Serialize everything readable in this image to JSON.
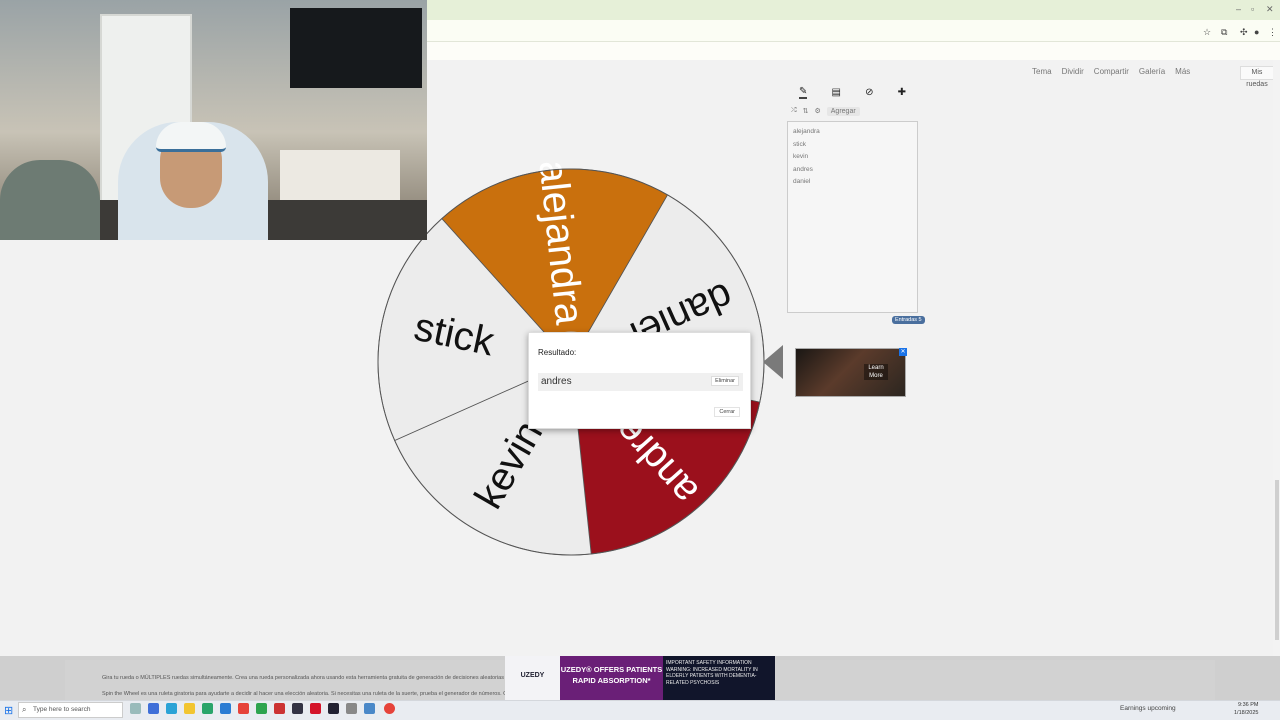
{
  "browser": {
    "window_controls": [
      "–",
      "▫",
      "✕"
    ]
  },
  "site_nav": {
    "items": [
      "Tema",
      "Dividir",
      "Compartir",
      "Galería",
      "Más"
    ],
    "language_button": "Mis ruedas"
  },
  "wheel": {
    "segments": [
      {
        "label": "daniel",
        "color": "#ececec"
      },
      {
        "label": "andres",
        "color": "#9b101c"
      },
      {
        "label": "kevin",
        "color": "#ececec"
      },
      {
        "label": "stick",
        "color": "#ececec"
      },
      {
        "label": "alejandra",
        "color": "#c9700d"
      }
    ]
  },
  "side_panel": {
    "tabs": [
      "pencil-icon",
      "clipboard-icon",
      "eye-off-icon",
      "add-image-icon"
    ],
    "toolbar": {
      "shuffle": "⤮",
      "sort": "⇅",
      "add_image_label": "Agregar"
    },
    "entries": [
      "alejandra",
      "stick",
      "kevin",
      "andres",
      "daniel"
    ],
    "entries_count": "Entradas 5"
  },
  "ad": {
    "learn_more": "Learn More"
  },
  "result_dialog": {
    "title": "Resultado:",
    "winner": "andres",
    "remove_label": "Eliminar",
    "close_label": "Cerrar"
  },
  "footer": {
    "line1": "Gira tu rueda o MÚLTIPLES ruedas simultáneamente. Crea una rueda personalizada ahora usando esta herramienta gratuita de generación de decisiones aleatorias en línea.",
    "line2": "Spin the Wheel es una ruleta giratoria para ayudarte a decidir al hacer una elección aleatoria. Si necesitas una ruleta de la suerte, prueba el generador de números. Gira tu rueda para obtener lo que necesitas."
  },
  "bottom_ad": {
    "brand": "UZEDY",
    "headline": "UZEDY® OFFERS PATIENTS RAPID ABSORPTION*",
    "safety": "IMPORTANT SAFETY INFORMATION WARNING: INCREASED MORTALITY IN ELDERLY PATIENTS WITH DEMENTIA-RELATED PSYCHOSIS"
  },
  "taskbar": {
    "search_placeholder": "Type here to search",
    "weather": "Earnings upcoming",
    "time": "9:36 PM",
    "date": "1/18/2025"
  }
}
